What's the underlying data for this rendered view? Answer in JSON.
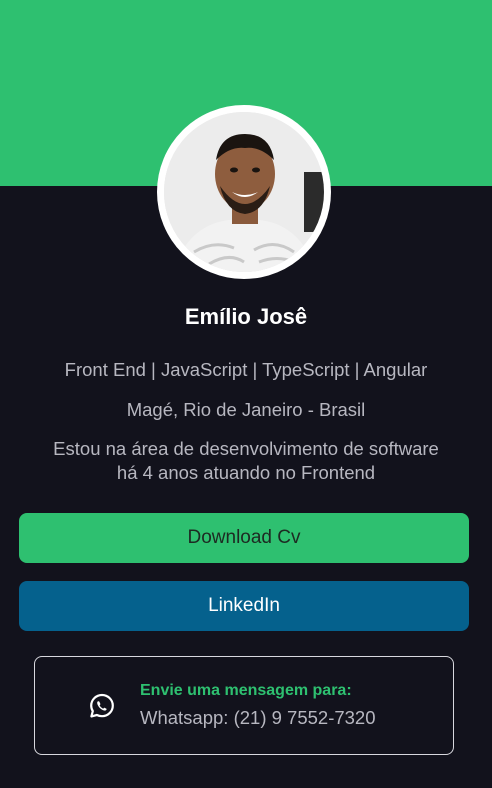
{
  "profile": {
    "name": "Emílio Josê",
    "roles": "Front End | JavaScript | TypeScript | Angular",
    "location": "Magé, Rio de Janeiro - Brasil",
    "bio_line1": "Estou na área de desenvolvimento de software",
    "bio_line2": "há 4 anos atuando no Frontend"
  },
  "buttons": {
    "download_cv": "Download Cv",
    "linkedin": "LinkedIn"
  },
  "whatsapp": {
    "title": "Envie uma mensagem para:",
    "phone": "Whatsapp: (21) 9 7552-7320",
    "icon": "whatsapp-icon"
  },
  "colors": {
    "accent_green": "#2ec070",
    "linkedin_blue": "#05618d",
    "background": "#12121c"
  }
}
